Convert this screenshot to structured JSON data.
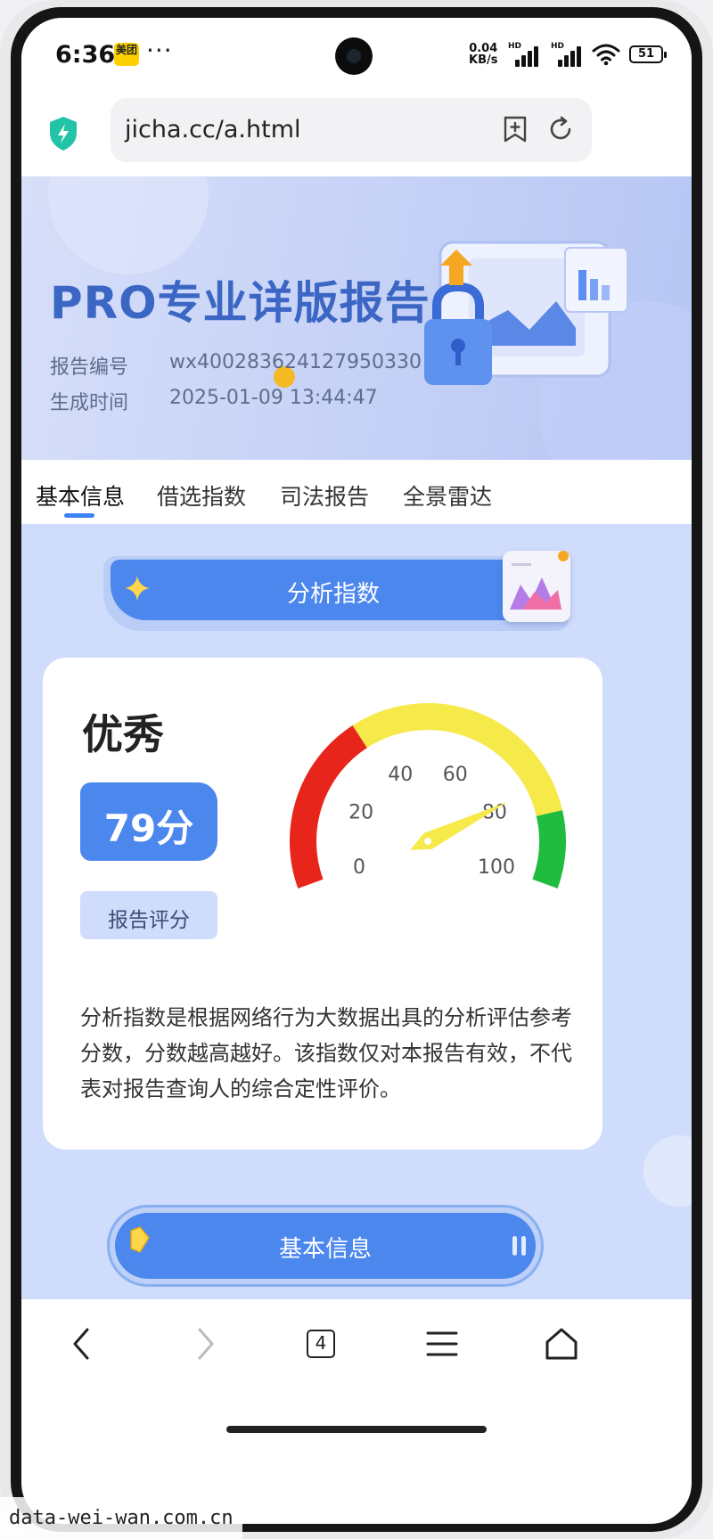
{
  "status_bar": {
    "time": "6:36",
    "meituan_badge": "美团",
    "overflow": "···",
    "net_speed_value": "0.04",
    "net_speed_unit": "KB/s",
    "signal_label": "HD",
    "battery": "51"
  },
  "browser": {
    "url": "jicha.cc/a.html",
    "icons": [
      "shield-icon",
      "bookmark-add-icon",
      "reload-icon"
    ]
  },
  "banner": {
    "title": "PRO专业详版报告",
    "report_no_label": "报告编号",
    "report_no_value": "wx400283624127950330",
    "time_label": "生成时间",
    "time_value": "2025-01-09 13:44:47"
  },
  "tabs": [
    {
      "label": "基本信息",
      "active": true
    },
    {
      "label": "借选指数",
      "active": false
    },
    {
      "label": "司法报告",
      "active": false
    },
    {
      "label": "全景雷达",
      "active": false
    }
  ],
  "section": {
    "title": "分析指数"
  },
  "score_card": {
    "grade": "优秀",
    "score_display": "79分",
    "score_value": 79,
    "score_caption": "报告评分",
    "gauge_ticks": [
      "0",
      "20",
      "40",
      "60",
      "80",
      "100"
    ],
    "gauge_colors": {
      "red": "#e8251a",
      "yellow": "#f6e94a",
      "green": "#1fbc3f",
      "needle": "#f6e94a"
    },
    "description": "分析指数是根据网络行为大数据出具的分析评估参考分数，分数越高越好。该指数仅对本报告有效，不代表对报告查询人的综合定性评价。"
  },
  "next_section": {
    "title": "基本信息"
  },
  "bottom_nav": {
    "tab_count": "4",
    "icons": [
      "back-icon",
      "forward-icon",
      "tabs-icon",
      "menu-icon",
      "home-icon"
    ]
  },
  "watermark": "data-wei-wan.com.cn",
  "accent_color": "#4c87ee"
}
